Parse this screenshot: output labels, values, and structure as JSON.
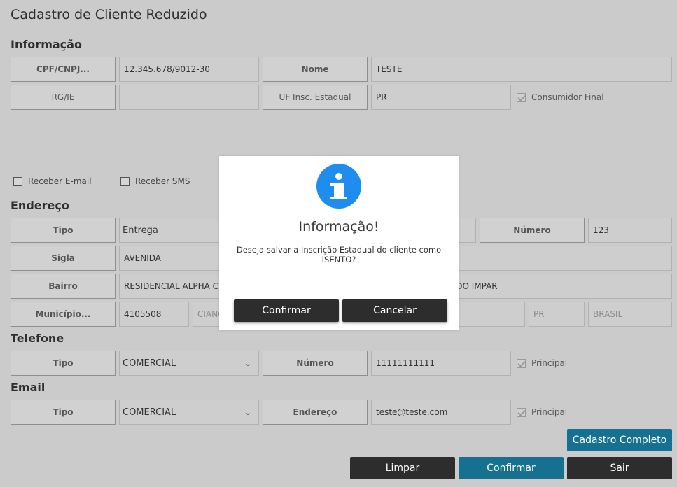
{
  "page_title": "Cadastro de Cliente Reduzido",
  "informacao": {
    "heading": "Informação",
    "cpf_label": "CPF/CNPJ...",
    "cpf_value": "12.345.678/9012-30",
    "nome_label": "Nome",
    "nome_value": "TESTE",
    "rg_label": "RG/IE",
    "rg_value": "",
    "uf_label": "UF Insc. Estadual",
    "uf_value": "PR",
    "consumidor_final": {
      "label": "Consumidor Final",
      "checked": true
    }
  },
  "receber_email": {
    "label": "Receber E-mail",
    "checked": false
  },
  "receber_sms": {
    "label": "Receber SMS",
    "checked": false
  },
  "endereco": {
    "heading": "Endereço",
    "tipo_label": "Tipo",
    "tipo_value": "Entrega",
    "numero_label": "Número",
    "numero_value": "123",
    "sigla_label": "Sigla",
    "sigla_value": "AVENIDA",
    "bairro_label": "Bairro",
    "bairro_value": "RESIDENCIAL ALPHA CLU",
    "complemento_visible": "ADO IMPAR",
    "municipio_label": "Município...",
    "municipio_code": "4105508",
    "municipio_name": "CIANO",
    "uf": "PR",
    "pais": "BRASIL"
  },
  "telefone": {
    "heading": "Telefone",
    "tipo_label": "Tipo",
    "tipo_value": "COMERCIAL",
    "numero_label": "Número",
    "numero_value": "11111111111",
    "principal": {
      "label": "Principal",
      "checked": true
    }
  },
  "email": {
    "heading": "Email",
    "tipo_label": "Tipo",
    "tipo_value": "COMERCIAL",
    "endereco_label": "Endereço",
    "endereco_value": "teste@teste.com",
    "principal": {
      "label": "Principal",
      "checked": true
    }
  },
  "buttons": {
    "cadastro_completo": "Cadastro Completo",
    "limpar": "Limpar",
    "confirmar": "Confirmar",
    "sair": "Sair"
  },
  "dialog": {
    "icon": "info-icon",
    "title": "Informação!",
    "message": "Deseja salvar a Inscrição Estadual do cliente como ISENTO?",
    "confirm": "Confirmar",
    "cancel": "Cancelar"
  },
  "colors": {
    "overlay_background": "#cbcbcb",
    "dark_button": "#2d2d2d",
    "teal_button": "#15718f",
    "info_icon": "#1e8ded"
  }
}
